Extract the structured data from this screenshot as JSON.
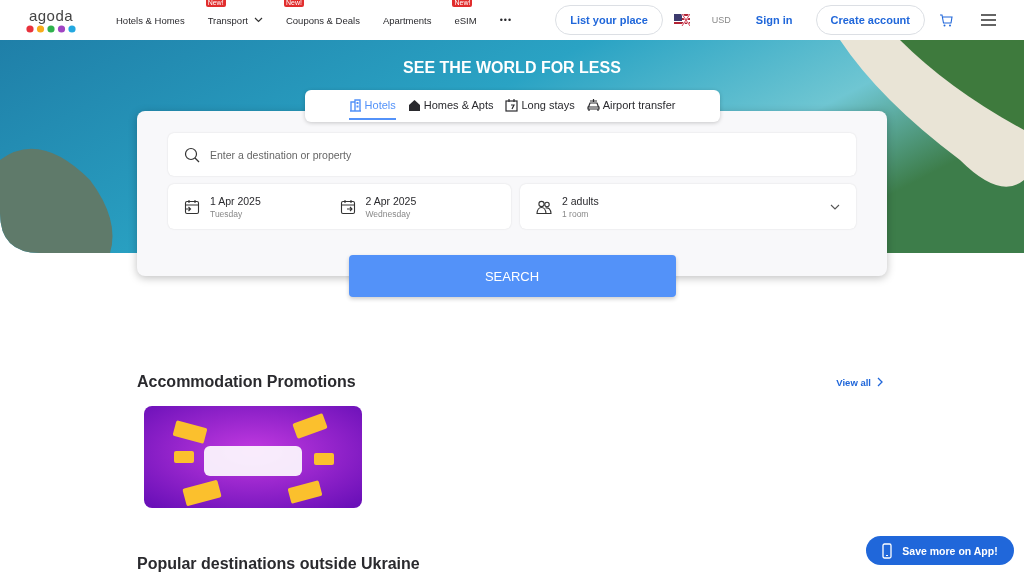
{
  "header": {
    "logo": "agoda",
    "nav": [
      {
        "label": "Hotels & Homes",
        "has_menu": false
      },
      {
        "label": "Transport",
        "badge": "New!",
        "has_menu": true
      },
      {
        "label": "Coupons & Deals",
        "badge": "New!",
        "has_menu": false
      },
      {
        "label": "Apartments",
        "has_menu": false
      },
      {
        "label": "eSIM",
        "badge": "New!",
        "has_menu": false
      }
    ],
    "more": "•••",
    "list_place": "List your place",
    "currency": "USD",
    "sign_in": "Sign in",
    "create_account": "Create account"
  },
  "hero": {
    "title": "SEE THE WORLD FOR LESS",
    "tabs": [
      {
        "label": "Hotels",
        "selected": true
      },
      {
        "label": "Homes & Apts",
        "selected": false
      },
      {
        "label": "Long stays",
        "selected": false
      },
      {
        "label": "Airport transfer",
        "selected": false
      }
    ],
    "search": {
      "placeholder": "Enter a destination or property",
      "check_in": {
        "date": "1 Apr 2025",
        "day": "Tuesday"
      },
      "check_out": {
        "date": "2 Apr 2025",
        "day": "Wednesday"
      },
      "guests": {
        "count": "2 adults",
        "rooms": "1 room"
      },
      "button": "SEARCH"
    }
  },
  "promotions": {
    "title": "Accommodation Promotions",
    "view_all": "View all"
  },
  "popular": {
    "title": "Popular destinations outside Ukraine"
  },
  "app_button": "Save more on App!"
}
